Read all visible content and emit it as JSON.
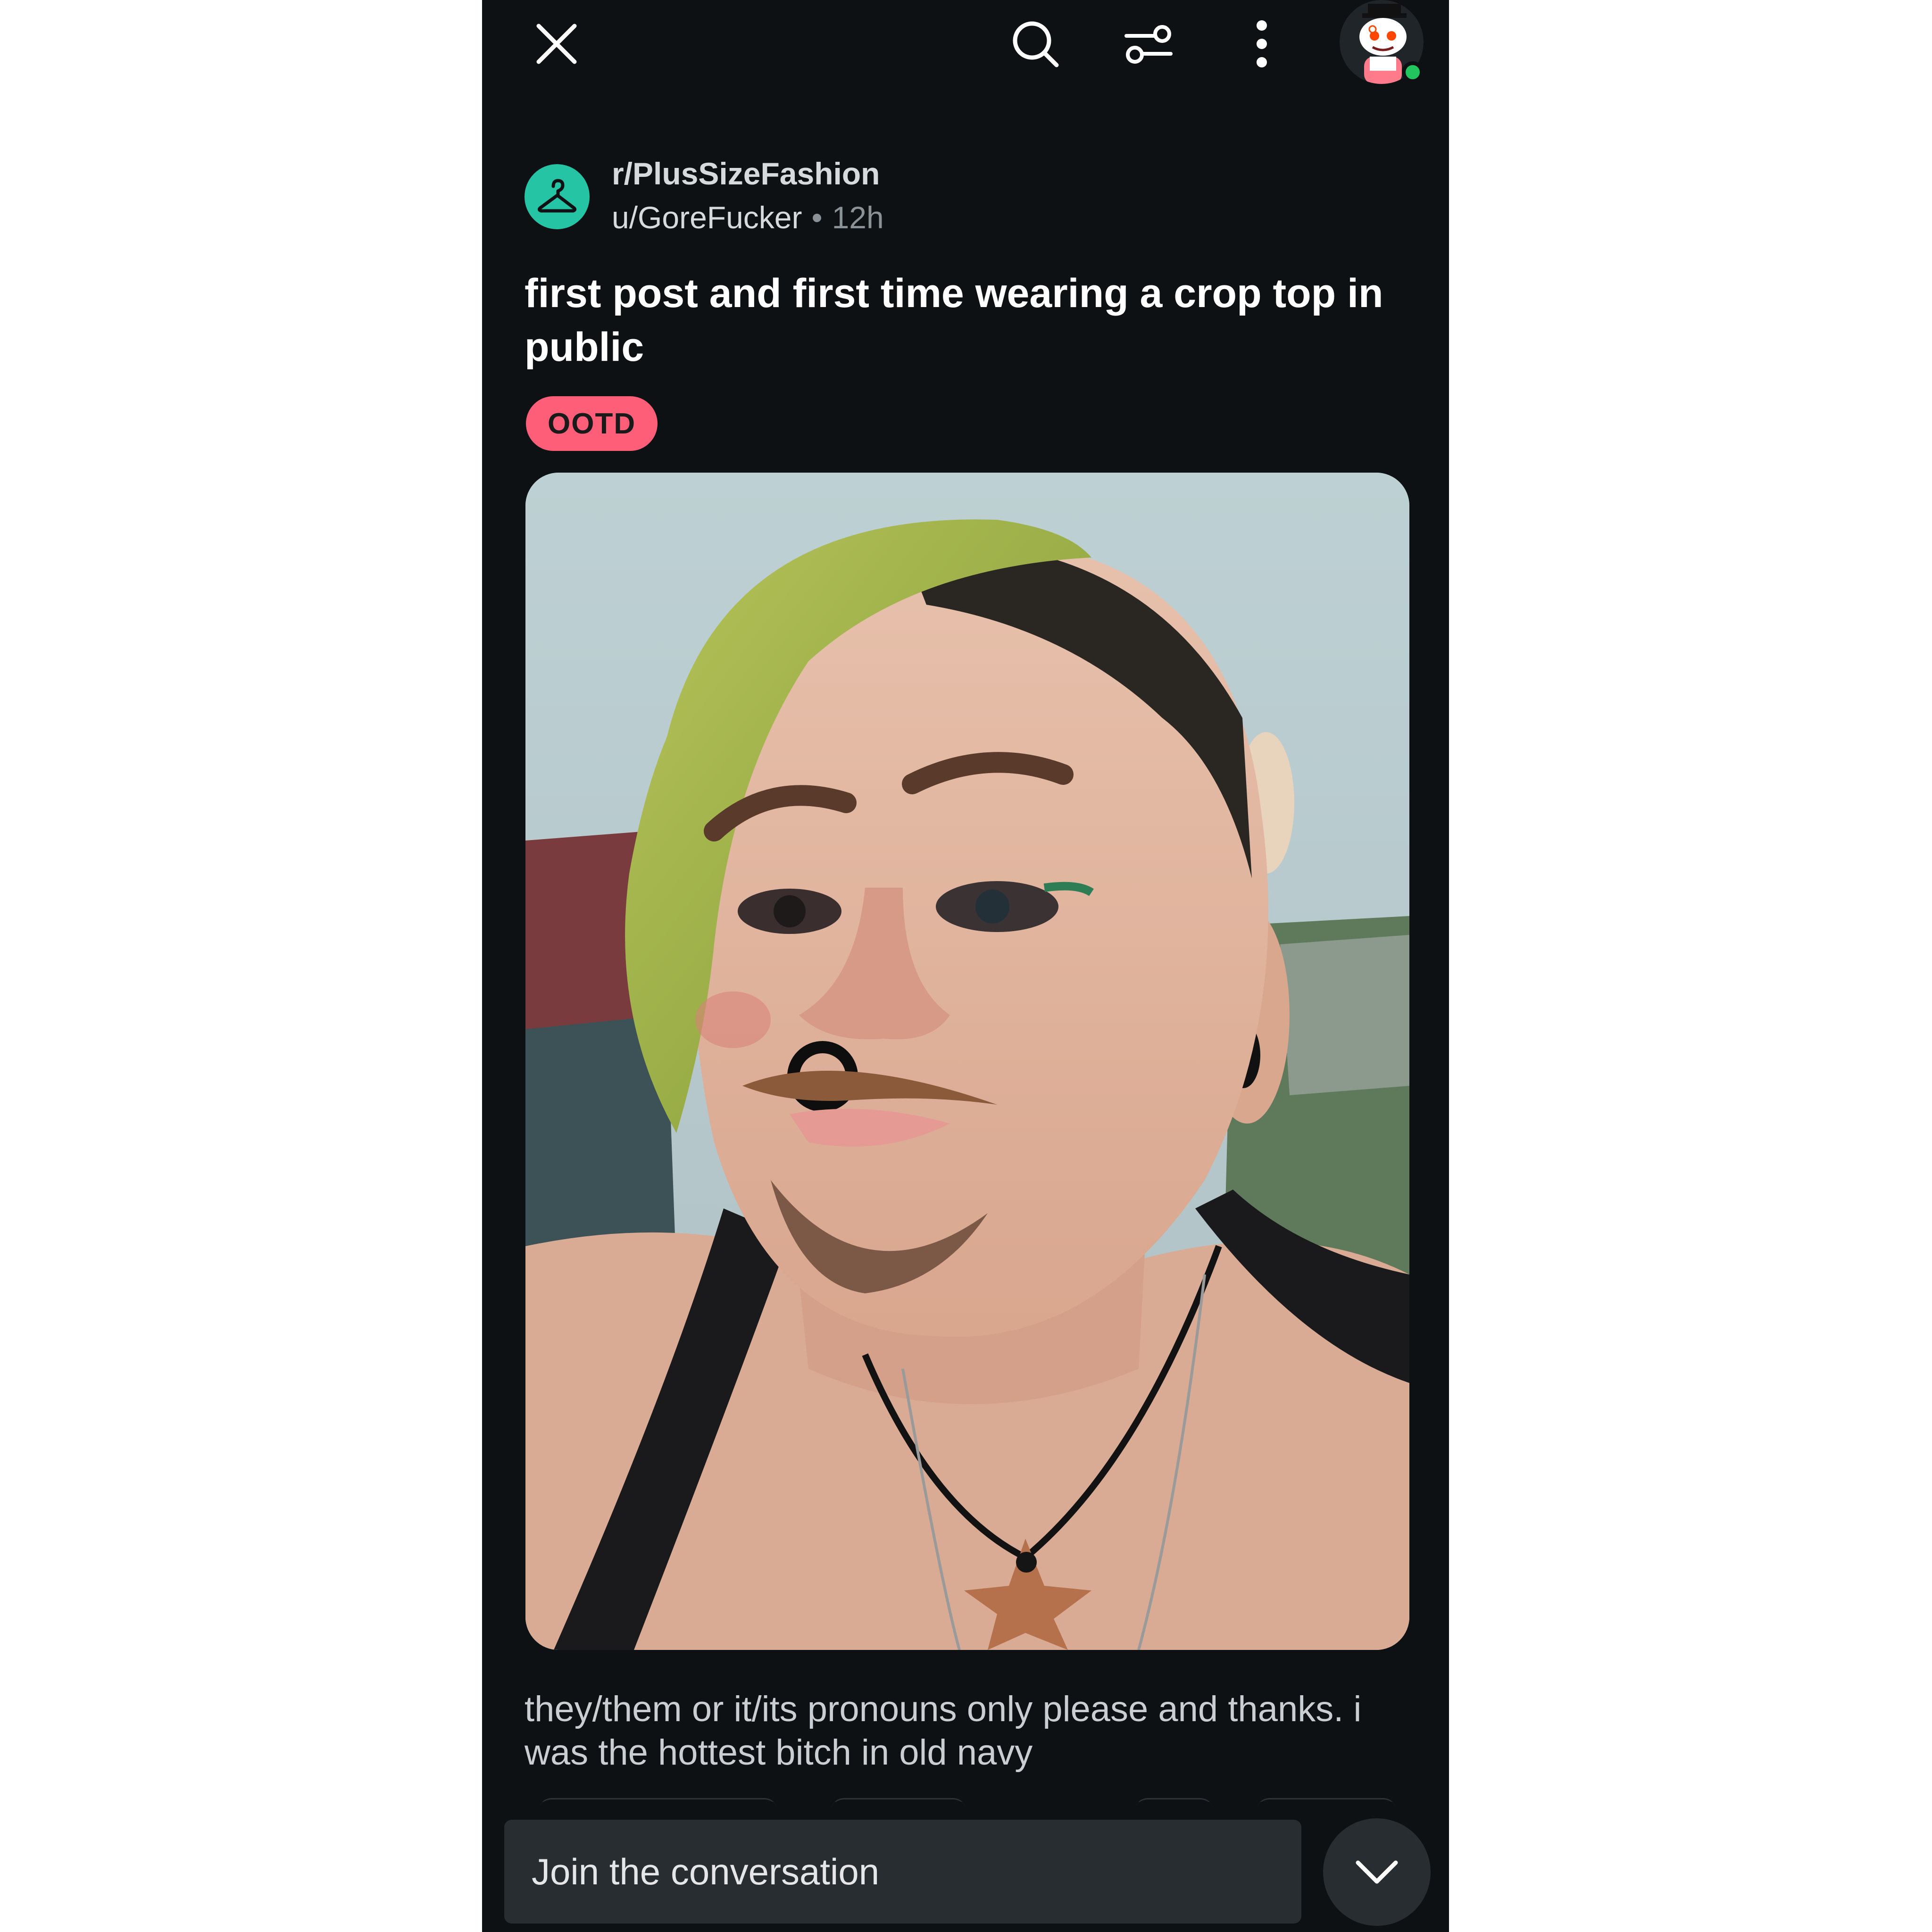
{
  "toolbar": {
    "icons": [
      "close-icon",
      "search-icon",
      "filter-icon",
      "more-vertical-icon",
      "user-avatar"
    ],
    "online_status_color": "#22c55e"
  },
  "post": {
    "subreddit": "r/PlusSizeFashion",
    "subreddit_icon": "hanger-icon",
    "subreddit_color": "#24c4a4",
    "author": "u/GoreFucker",
    "separator": "•",
    "age": "12h",
    "title": "first post and first time wearing a crop top in public",
    "flair": "OOTD",
    "flair_color": "#ff5e79",
    "body": "they/them or it/its pronouns only please and thanks. i was the hottest bitch in old navy"
  },
  "composer": {
    "placeholder": "Join the conversation",
    "collapse_icon": "chevron-down-icon"
  }
}
